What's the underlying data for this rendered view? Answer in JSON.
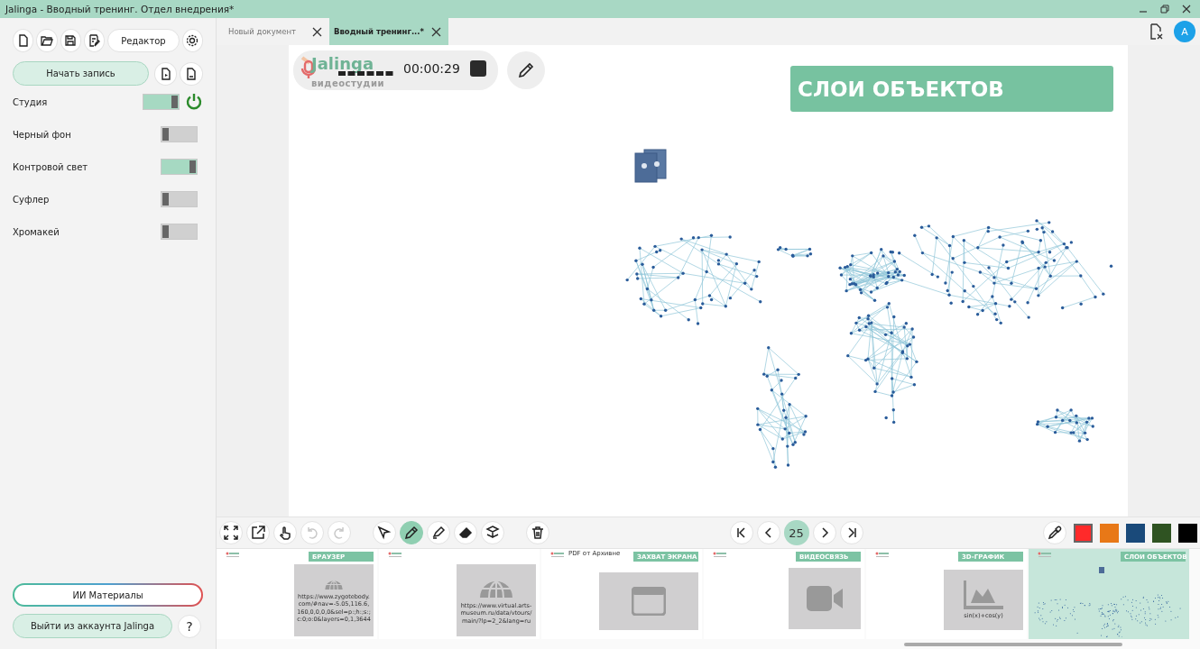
{
  "window": {
    "title": "Jalinga - Вводный тренинг. Отдел внедрения*"
  },
  "sidebar": {
    "editor_button": "Редактор",
    "record_button": "Начать запись",
    "toggles": [
      {
        "label": "Студия",
        "on": true,
        "power": true
      },
      {
        "label": "Черный фон",
        "on": false
      },
      {
        "label": "Контровой свет",
        "on": true
      },
      {
        "label": "Суфлер",
        "on": false
      },
      {
        "label": "Хромакей",
        "on": false
      }
    ],
    "ai_button": "ИИ Материалы",
    "logout_button": "Выйти из аккаунта Jalinga",
    "help_button": "?"
  },
  "tabs": [
    {
      "label": "Новый документ",
      "selected": false
    },
    {
      "label": "Вводный тренинг...*",
      "selected": true
    }
  ],
  "account": {
    "initial": "A"
  },
  "slide": {
    "logo_name": "Jalinga",
    "logo_subtitle": "видеостудии",
    "timer": "00:00:29",
    "title": "СЛОИ ОБЪЕКТОВ"
  },
  "toolbar": {
    "tools": [
      {
        "kind": "expand",
        "selected": false,
        "disabled": false
      },
      {
        "kind": "export",
        "selected": false,
        "disabled": false
      },
      {
        "kind": "hand",
        "selected": false,
        "disabled": false
      },
      {
        "kind": "undo",
        "selected": false,
        "disabled": true
      },
      {
        "kind": "redo",
        "selected": false,
        "disabled": true
      },
      {
        "kind": "gap"
      },
      {
        "kind": "pointer",
        "selected": false,
        "disabled": false
      },
      {
        "kind": "pen",
        "selected": true,
        "disabled": false
      },
      {
        "kind": "marker",
        "selected": false,
        "disabled": false
      },
      {
        "kind": "eraser",
        "selected": false,
        "disabled": false
      },
      {
        "kind": "layers",
        "selected": false,
        "disabled": false
      },
      {
        "kind": "gap"
      },
      {
        "kind": "trash",
        "selected": false,
        "disabled": false
      }
    ],
    "page": "25",
    "colors": [
      {
        "color": "#ff2a2a",
        "selected": true
      },
      {
        "color": "#e87817",
        "selected": false
      },
      {
        "color": "#1a4a7a",
        "selected": false
      },
      {
        "color": "#2f5322",
        "selected": false
      },
      {
        "color": "#000000",
        "selected": false
      }
    ]
  },
  "thumbnails": [
    {
      "kind": "browser",
      "title": "БРАУЗЕР",
      "caption": "https://www.zygotebody.com/#nav=-5.05,116.6,160,0,0,0,0&sel=p:;h:;s:;c:0;o:0&layers=0,1,3644",
      "selected": false
    },
    {
      "kind": "browser",
      "caption": "https://www.virtual.arts-museum.ru/data/vtours/main/?lp=2_2&lang=ru",
      "selected": false
    },
    {
      "kind": "screen",
      "title": "ЗАХВАТ ЭКРАНА",
      "note": "PDF от Архивне",
      "selected": false
    },
    {
      "kind": "video",
      "title": "ВИДЕОСВЯЗЬ",
      "selected": false
    },
    {
      "kind": "graph",
      "title": "3D-ГРАФИК",
      "caption": "sin(x)+cos(y)",
      "selected": false
    },
    {
      "kind": "layers",
      "title": "СЛОИ ОБЪЕКТОВ",
      "selected": true
    }
  ]
}
